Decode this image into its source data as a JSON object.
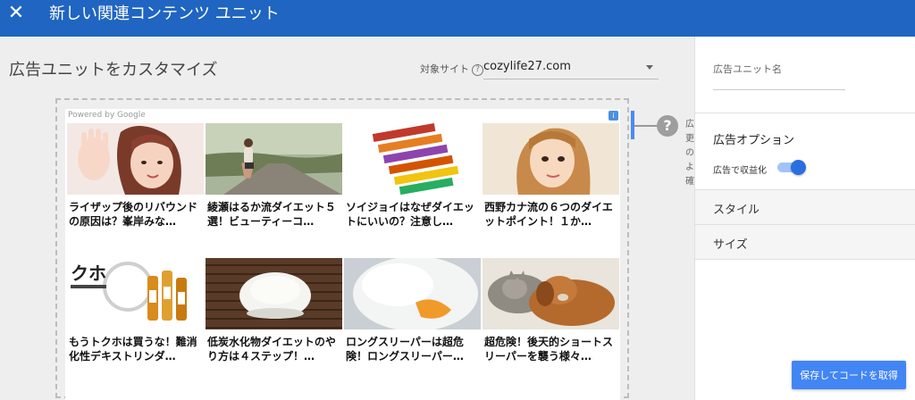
{
  "topbar": {
    "close_glyph": "✕",
    "title": "新しい関連コンテンツ ユニット"
  },
  "main": {
    "title": "広告ユニットをカスタマイズ",
    "site_label": "対象サイト",
    "site_help_glyph": "?",
    "site_value": "cozylife27.com"
  },
  "ad": {
    "powered_by": "Powered by Google",
    "adchoices": "i",
    "cards": [
      {
        "title": "ライザップ後のリバウンドの原因は？峯岸みな…",
        "image": "woman-waving"
      },
      {
        "title": "綾瀬はるか流ダイエット５選！ビューティーコ…",
        "image": "runner"
      },
      {
        "title": "ソイジョイはなぜダイエットにいいの？注意し…",
        "image": "snack-bars"
      },
      {
        "title": "西野カナ流の６つのダイエットポイント！１か…",
        "image": "woman-portrait"
      },
      {
        "title": "もうトクホは買うな！難消化性デキストリンダ…",
        "image": "tokuho-drinks"
      },
      {
        "title": "低炭水化物ダイエットのやり方は４ステップ！…",
        "image": "rice-bowl"
      },
      {
        "title": "ロングスリーパーは超危険！ロングスリーパー…",
        "image": "sleeping-duck"
      },
      {
        "title": "超危険！後天的ショートスリーパーを襲う様々…",
        "image": "sleeping-pets"
      }
    ]
  },
  "help_side": {
    "glyph": "?",
    "text": "広更のよ確"
  },
  "panel": {
    "unit_name_label": "広告ユニット名",
    "unit_name_value": "",
    "options_title": "広告オプション",
    "monetize_label": "広告で収益化",
    "monetize_on": true,
    "style_label": "スタイル",
    "size_label": "サイズ",
    "save_label": "保存してコードを取得"
  },
  "colors": {
    "accent": "#4285f4",
    "topbar": "#1f65c1"
  }
}
